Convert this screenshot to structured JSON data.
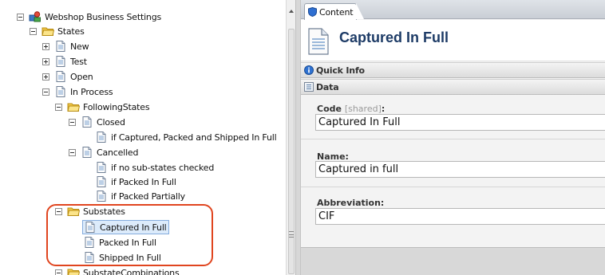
{
  "tree": {
    "root": {
      "label": "Webshop Business Settings"
    },
    "states": {
      "label": "States"
    },
    "new": {
      "label": "New"
    },
    "test": {
      "label": "Test"
    },
    "open": {
      "label": "Open"
    },
    "in_process": {
      "label": "In Process"
    },
    "following_states": {
      "label": "FollowingStates"
    },
    "closed": {
      "label": "Closed"
    },
    "closed_condition": {
      "label": "if Captured, Packed and Shipped In Full"
    },
    "cancelled": {
      "label": "Cancelled"
    },
    "cancelled_conditions": [
      {
        "label": "if no sub-states checked"
      },
      {
        "label": "if Packed In Full"
      },
      {
        "label": "if Packed Partially"
      }
    ],
    "substates": {
      "label": "Substates"
    },
    "substate_items": [
      {
        "label": "Captured In Full",
        "selected": true
      },
      {
        "label": "Packed In Full"
      },
      {
        "label": "Shipped In Full"
      }
    ],
    "substate_combinations": {
      "label": "SubstateCombinations"
    }
  },
  "tabs": [
    {
      "label": "Content",
      "active": true
    }
  ],
  "content": {
    "title": "Captured In Full",
    "sections": [
      {
        "label": "Quick Info"
      },
      {
        "label": "Data"
      }
    ],
    "fields": {
      "code": {
        "label": "Code",
        "shared_tag": "[shared]",
        "suffix": ":",
        "value": "Captured In Full"
      },
      "name": {
        "label": "Name:",
        "value": "Captured in full"
      },
      "abbreviation": {
        "label": "Abbreviation:",
        "value": "CIF"
      }
    }
  },
  "colors": {
    "highlight": "#e0451f",
    "title": "#1d3b66",
    "selection": "#dcebfb"
  }
}
